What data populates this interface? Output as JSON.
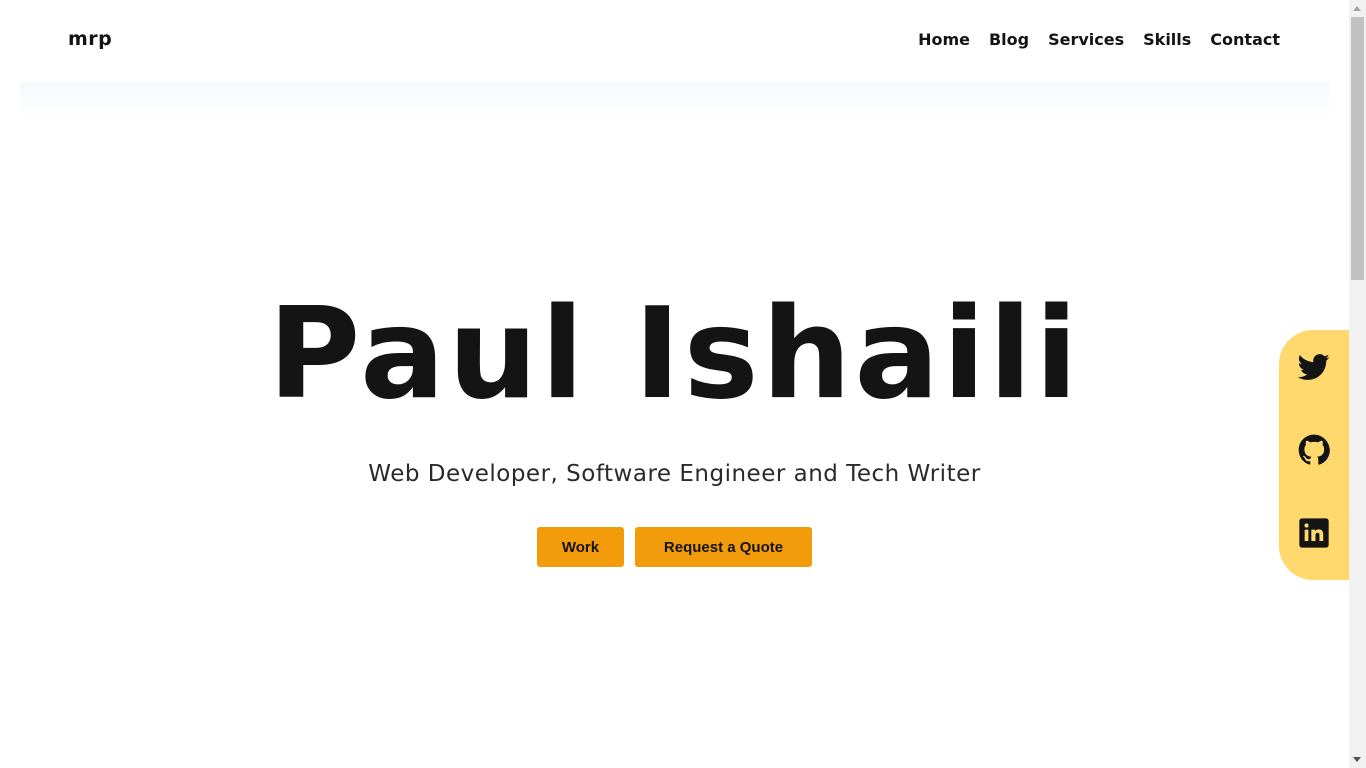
{
  "nav": {
    "brand": "mrp",
    "links": [
      {
        "label": "Home"
      },
      {
        "label": "Blog"
      },
      {
        "label": "Services"
      },
      {
        "label": "Skills"
      },
      {
        "label": "Contact"
      }
    ]
  },
  "hero": {
    "title": "Paul Ishaili",
    "subtitle": "Web Developer, Software Engineer and Tech Writer",
    "buttons": {
      "work": "Work",
      "quote": "Request a Quote"
    }
  },
  "social": {
    "panel_color": "#ffd96e",
    "icons": [
      "twitter-icon",
      "github-icon",
      "linkedin-icon"
    ]
  },
  "colors": {
    "accent": "#f39c0b",
    "text": "#141414"
  }
}
